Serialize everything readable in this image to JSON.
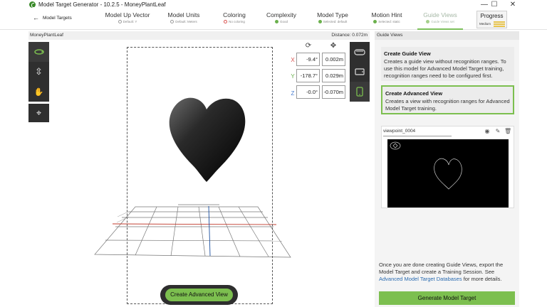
{
  "window": {
    "title": "Model Target Generator - 10.2.5 - MoneyPlantLeaf",
    "minimize": "—",
    "maximize": "☐",
    "close": "✕"
  },
  "nav": {
    "back_label": "Model Targets"
  },
  "steps": [
    {
      "label": "Model Up Vector",
      "status": "Default: Y",
      "status_color": "#9a9a9a"
    },
    {
      "label": "Model Units",
      "status": "Default: Meters",
      "status_color": "#9a9a9a"
    },
    {
      "label": "Coloring",
      "status": "No coloring",
      "status_color": "#d9534f"
    },
    {
      "label": "Complexity",
      "status": "Good",
      "status_color": "#6ab04c"
    },
    {
      "label": "Model Type",
      "status": "Selected: default",
      "status_color": "#6ab04c"
    },
    {
      "label": "Motion Hint",
      "status": "Selected: static",
      "status_color": "#6ab04c"
    },
    {
      "label": "Guide Views",
      "status": "Guide Views set",
      "status_color": "#6ab04c"
    }
  ],
  "progress": {
    "label": "Progress",
    "level": "Medium",
    "bar_color": "#e7c34a"
  },
  "viewport": {
    "model_name": "MoneyPlantLeaf",
    "distance": "Distance: 0.072m",
    "create_advanced_view": "Create Advanced View",
    "accent_color": "#7cbf4f"
  },
  "transform": {
    "rows": [
      {
        "axis": "X",
        "rotation": "-9.4°",
        "position": "0.002m",
        "color": "#d9534f"
      },
      {
        "axis": "Y",
        "rotation": "-178.7°",
        "position": "0.029m",
        "color": "#6ab04c"
      },
      {
        "axis": "Z",
        "rotation": "-0.0°",
        "position": "-0.070m",
        "color": "#4a7fd0"
      }
    ]
  },
  "panel": {
    "title": "Guide Views",
    "guide_card": {
      "title": "Create Guide View",
      "desc": "Creates a guide view without recognition ranges. To use this model for Advanced Model Target training, recognition ranges need to be configured first."
    },
    "advanced_card": {
      "title": "Create Advanced View",
      "desc": "Creates a view with recognition ranges for Advanced Model Target training."
    },
    "viewpoint": {
      "name": "viewpoint_0004"
    },
    "export_text": "Once you are done creating Guide Views, export the Model Target and create a Training Session. See",
    "export_link": "Advanced Model Target Databases",
    "export_tail": "for more details.",
    "generate_button": "Generate Model Target"
  }
}
